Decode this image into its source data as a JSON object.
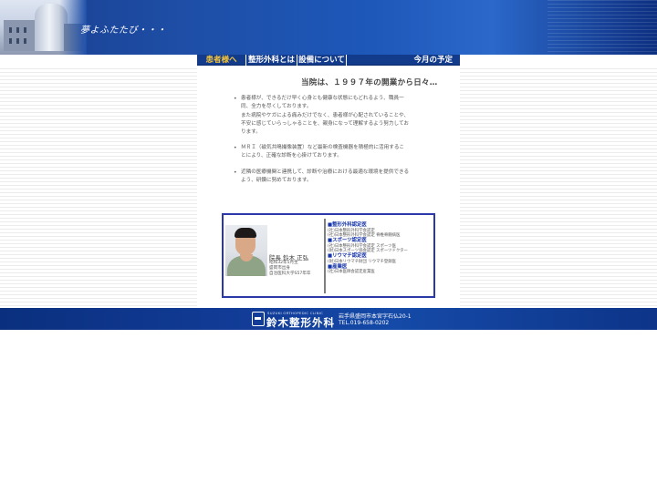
{
  "header": {
    "slogan": "夢よふたたび・・・"
  },
  "nav": {
    "items": [
      {
        "label": "患者様へ",
        "active": true
      },
      {
        "label": "整形外科とは",
        "active": false
      },
      {
        "label": "設備について",
        "active": false
      },
      {
        "label": "今月の予定",
        "active": false
      }
    ]
  },
  "content": {
    "headline": "当院は、１９９７年の開業から日々…",
    "bullets": [
      {
        "lines": [
          "患者様が、できるだけ早く心身とも健康な状態にもどれるよう、職員一",
          "同、全力を尽くしております。",
          "また病院やケガによる痛みだけでなく、患者様が心配されていることや、",
          "不安に感じていらっしゃることを、親身になって理解するよう努力してお",
          "ります。"
        ]
      },
      {
        "lines": [
          "ＭＲＩ（磁気共鳴撮像装置）など最新の検査機器を積極的に活用するこ",
          "とにより、正確な診断を心掛けております。"
        ]
      },
      {
        "lines": [
          "近隣の医療機関と連携して、診断や治療における最適な環境を提供できる",
          "よう、研鑽に努めております。"
        ]
      }
    ]
  },
  "profile": {
    "title_name": "院長 鈴木 正弘",
    "career": [
      "昭和32年5月生",
      "盛岡市出身",
      "自治医科大学S57年卒"
    ],
    "certs": [
      {
        "head": "■整形外科認定医",
        "lines": [
          "(社)日本整形外科学会認定",
          "(社)日本整形外科学会認定 脊椎脊髄病医"
        ]
      },
      {
        "head": "■スポーツ認定医",
        "lines": [
          "(社)日本整形外科学会認定 スポーツ医",
          "(財)日本スポーツ協会認定 スポーツドクター"
        ]
      },
      {
        "head": "■リウマチ認定医",
        "lines": [
          "(財)日本リウマチ財団 リウマチ登録医"
        ]
      },
      {
        "head": "■産業医",
        "lines": [
          "(社)日本医師会認定産業医"
        ]
      }
    ]
  },
  "footer": {
    "name_en": "SUZUKI ORTHOPEDIC CLINIC",
    "name": "鈴木整形外科",
    "address": "岩手県盛岡市本宮字石仏20-1",
    "tel": "TEL.019-658-0202"
  },
  "colors": {
    "header_blue": "#1e4fa8",
    "nav_blue": "#133b8c",
    "nav_active": "#f2c23a",
    "cert_heading": "#1533a8",
    "profile_border": "#2a38a8"
  }
}
